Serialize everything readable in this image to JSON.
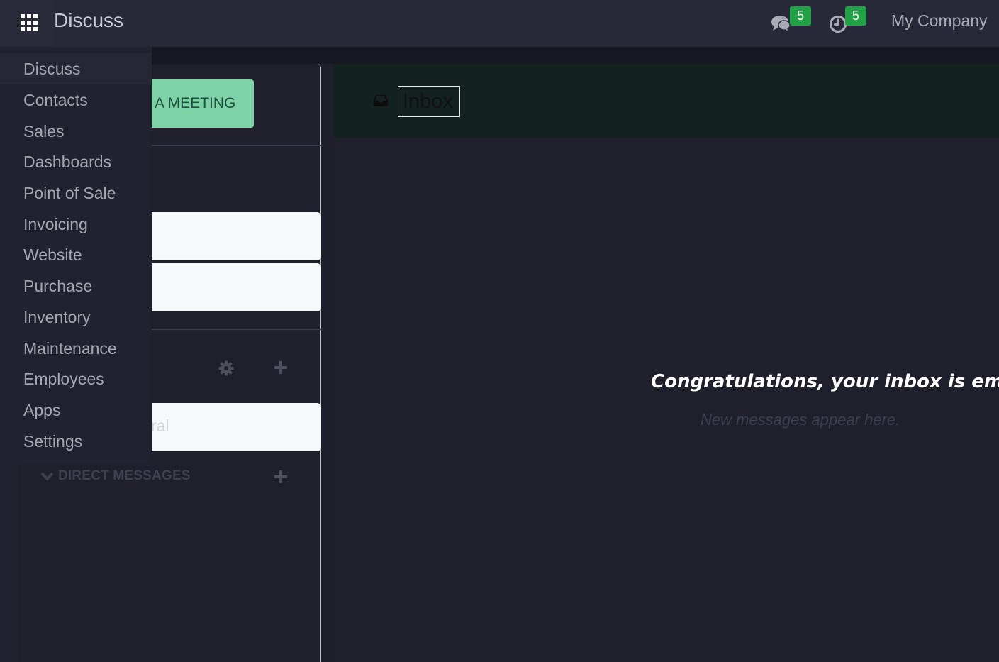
{
  "navbar": {
    "app_title": "Discuss",
    "messages_badge": "5",
    "activities_badge": "5",
    "company": "My Company"
  },
  "app_menu": {
    "items": [
      {
        "label": "Discuss",
        "active": true
      },
      {
        "label": "Contacts"
      },
      {
        "label": "Sales"
      },
      {
        "label": "Dashboards"
      },
      {
        "label": "Point of Sale"
      },
      {
        "label": "Invoicing"
      },
      {
        "label": "Website"
      },
      {
        "label": "Purchase"
      },
      {
        "label": "Inventory"
      },
      {
        "label": "Maintenance"
      },
      {
        "label": "Employees"
      },
      {
        "label": "Apps"
      },
      {
        "label": "Settings"
      }
    ]
  },
  "sidebar": {
    "meeting_button_label": "A MEETING",
    "channel_partial": "ral",
    "direct_messages_label": "DIRECT MESSAGES"
  },
  "main": {
    "title": "Inbox",
    "empty_title": "Congratulations, your inbox is empty",
    "empty_subtitle": "New messages appear here."
  },
  "colors": {
    "accent_green": "#21a045",
    "meeting_button": "#7ed3a6",
    "background": "#1f202c"
  }
}
